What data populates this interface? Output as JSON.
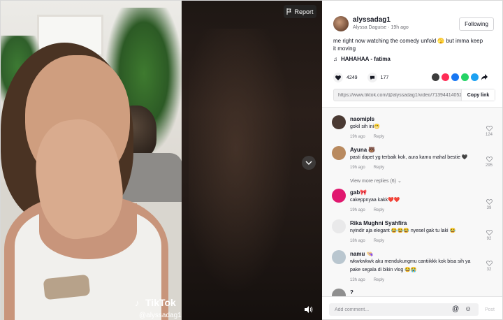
{
  "video": {
    "watermark_brand": "TikTok",
    "watermark_user": "@alyssadag1",
    "report_label": "Report"
  },
  "post": {
    "username": "alyssadag1",
    "display_name": "Alyssa Daguise",
    "time": "19h ago",
    "follow_label": "Following",
    "caption": "me right now watching the comedy unfold 🫣 but imma keep it moving",
    "music": "HAHAHAA - fatima",
    "likes": "4249",
    "comments_count": "177",
    "link": "https://www.tiktok.com/@alyssadag1/video/7139441405205...",
    "copy_label": "Copy link",
    "share_colors": [
      "#3c3c3c",
      "#fe2c55",
      "#1877f2",
      "#25d366",
      "#1da1f2"
    ]
  },
  "comments": [
    {
      "name": "naomipls",
      "text": "gokil sih ini😬",
      "time": "19h ago",
      "reply": "Reply",
      "likes": "124",
      "avatar_color": "#4a3a33"
    },
    {
      "name": "Ayuna 🐻",
      "text": "pasti dapet yg terbaik kok, aura kamu mahal bestie 🖤",
      "time": "19h ago",
      "reply": "Reply",
      "likes": "295",
      "avatar_color": "#b98a5f"
    },
    {
      "name": "gab🎀",
      "text": "cakeppnyaa kakk❤️❤️",
      "time": "19h ago",
      "reply": "Reply",
      "likes": "39",
      "avatar_color": "#e0186f"
    },
    {
      "name": "Rika Mughni Syahfira",
      "text": "nyindir aja elegant 😂😂😂 nyesel gak tu laki 😂",
      "time": "18h ago",
      "reply": "Reply",
      "likes": "92",
      "avatar_color": "#e9e9ea"
    },
    {
      "name": "namu 👒",
      "text": "wkwkwkwk aku mendukungmu cantiikkk kok bisa sih ya pake segala di bikin vlog 😂😭",
      "time": "13h ago",
      "reply": "Reply",
      "likes": "32",
      "avatar_color": "#b9c6cf"
    },
    {
      "name": "?",
      "avatar_color": "#8f8f8f"
    }
  ],
  "view_more": "View more replies (6)",
  "compose": {
    "placeholder": "Add comment...",
    "post_label": "Post"
  }
}
